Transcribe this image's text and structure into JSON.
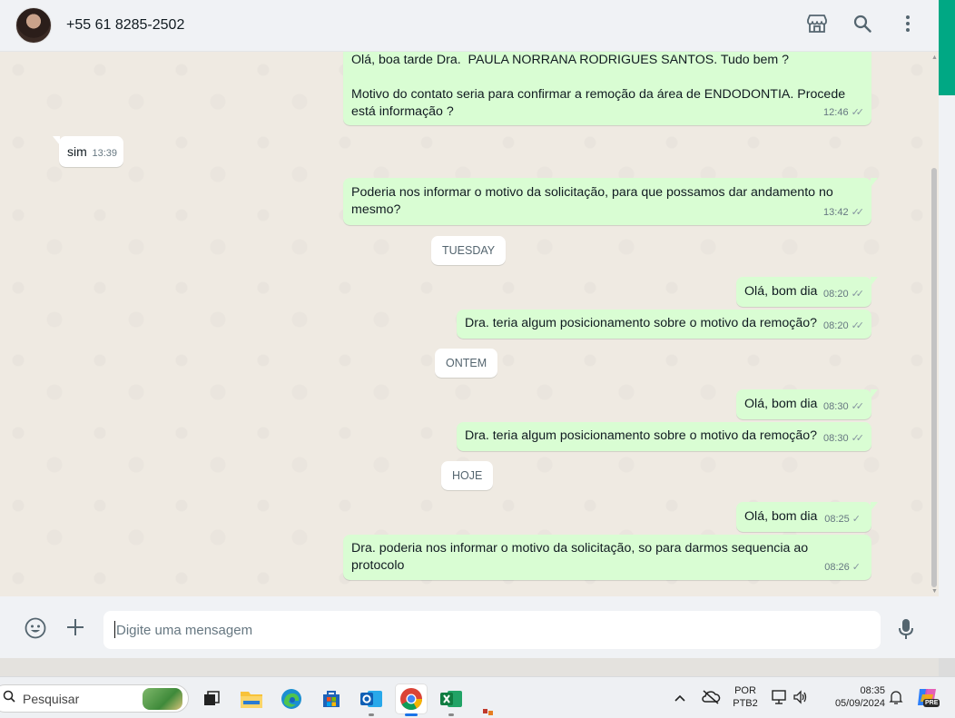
{
  "header": {
    "contact_name": "+55 61 8285-2502",
    "icons": [
      "store-icon",
      "search-icon",
      "more-options-icon"
    ]
  },
  "chat": {
    "messages": [
      {
        "dir": "out",
        "text": "Olá, boa tarde Dra.  PAULA NORRANA RODRIGUES SANTOS. Tudo bem ?\n\nMotivo do contato seria para confirmar a remoção da área de ENDODONTIA. Procede está informação ?",
        "time": "12:46",
        "status": "read"
      },
      {
        "dir": "in",
        "text": "sim",
        "time": "13:39"
      },
      {
        "dir": "out",
        "text": "Poderia nos informar o motivo da solicitação, para que possamos dar andamento no mesmo?",
        "time": "13:42",
        "status": "read"
      },
      {
        "dir": "out",
        "text": "Olá, bom dia",
        "time": "08:20",
        "status": "read"
      },
      {
        "dir": "out",
        "text": "Dra. teria algum posicionamento sobre o motivo da remoção?",
        "time": "08:20",
        "status": "read"
      },
      {
        "dir": "out",
        "text": "Olá, bom dia",
        "time": "08:30",
        "status": "read"
      },
      {
        "dir": "out",
        "text": "Dra. teria algum posicionamento sobre o motivo da remoção?",
        "time": "08:30",
        "status": "read"
      },
      {
        "dir": "out",
        "text": "Olá, bom dia",
        "time": "08:25",
        "status": "sent"
      },
      {
        "dir": "out",
        "text": "Dra. poderia nos informar o motivo da solicitação, so para darmos sequencia ao protocolo",
        "time": "08:26",
        "status": "sent"
      }
    ],
    "date_chips": [
      "TUESDAY",
      "ONTEM",
      "HOJE"
    ]
  },
  "composer": {
    "placeholder": "Digite uma mensagem"
  },
  "taskbar": {
    "search_placeholder": "Pesquisar",
    "language": "POR",
    "keyboard": "PTB2",
    "time": "08:35",
    "date": "05/09/2024",
    "copilot_badge": "PRE"
  },
  "colors": {
    "outgoing_bubble": "#d9fdd3",
    "incoming_bubble": "#ffffff",
    "chat_background": "#efeae2",
    "accent": "#00a884"
  }
}
